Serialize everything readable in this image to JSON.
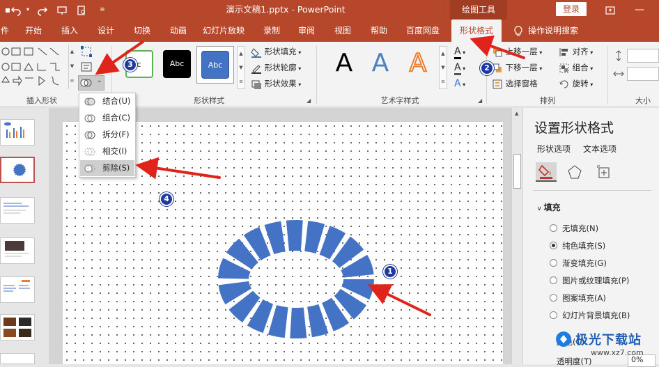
{
  "titlebar": {
    "undo_icon": "undo-icon",
    "redo_icon": "redo-icon",
    "title": "演示文稿1.pptx  -  PowerPoint",
    "context_tools": "绘图工具",
    "login": "登录"
  },
  "tabs": [
    "件",
    "开始",
    "插入",
    "设计",
    "切换",
    "动画",
    "幻灯片放映",
    "录制",
    "审阅",
    "视图",
    "帮助",
    "百度网盘",
    "形状格式"
  ],
  "active_tab": "形状格式",
  "tell_me": "操作说明搜索",
  "ribbon": {
    "insert_shapes_label": "插入形状",
    "shape_styles_label": "形状样式",
    "wordart_label": "艺术字样式",
    "arrange_label": "排列",
    "size_label": "大小",
    "style_samples": [
      "Abc",
      "Abc",
      "Abc"
    ],
    "shape_fill": "形状填充",
    "shape_outline": "形状轮廓",
    "shape_effects": "形状效果",
    "wordart_samples": [
      "A",
      "A",
      "A"
    ],
    "text_fill_letter": "A",
    "bring_forward": "上移一层",
    "send_backward": "下移一层",
    "selection_pane": "选择窗格",
    "align": "对齐",
    "group": "组合",
    "rotate": "旋转"
  },
  "merge_menu": {
    "items": [
      "结合(U)",
      "组合(C)",
      "拆分(F)",
      "相交(I)",
      "剪除(S)"
    ],
    "highlighted": "剪除(S)"
  },
  "format_pane": {
    "title": "设置形状格式",
    "tab_shape": "形状选项",
    "tab_text": "文本选项",
    "section_fill": "填充",
    "fill_options": [
      "无填充(N)",
      "纯色填充(S)",
      "渐变填充(G)",
      "图片或纹理填充(P)",
      "图案填充(A)",
      "幻灯片背景填充(B)"
    ],
    "selected_fill": "纯色填充(S)",
    "color_label": "颜色(C)",
    "transparency_label": "透明度(T)",
    "transparency_value": "0%"
  },
  "annotations": [
    "1",
    "2",
    "3",
    "4"
  ],
  "watermark": {
    "brand": "极光下载站",
    "url": "www.xz7.com"
  },
  "colors": {
    "accent": "#b7472a",
    "shape_fill": "#4472c4",
    "arrow": "#e0241b",
    "badge": "#1e3a9e"
  }
}
